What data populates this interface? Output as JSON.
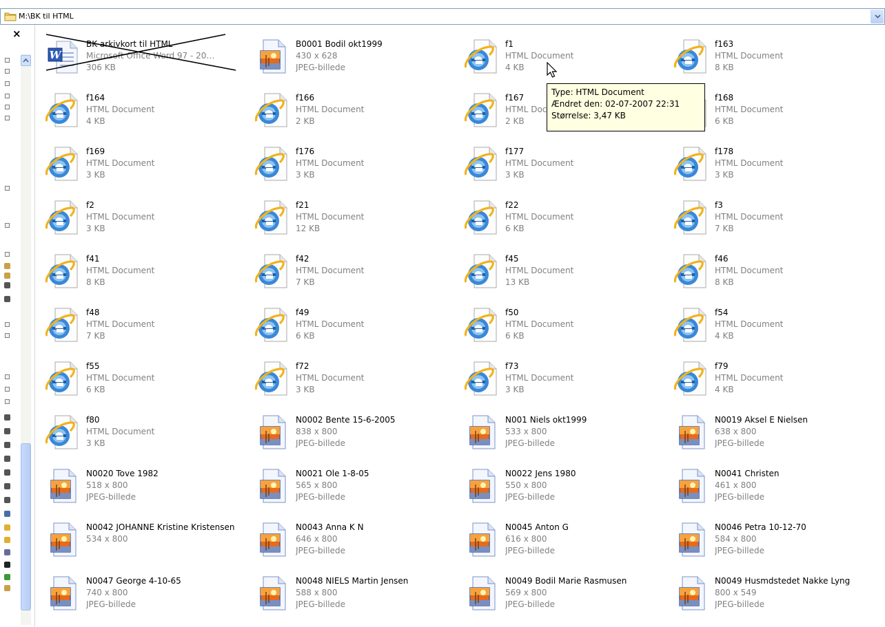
{
  "address": {
    "path": "M:\\BK til HTML"
  },
  "leftpane": {
    "close_label": "×"
  },
  "tooltip": {
    "type": "Type: HTML Document",
    "modified": "Ændret den: 02-07-2007 22:31",
    "size": "Størrelse: 3,47 KB"
  },
  "files": [
    {
      "name": "BK arkivkort til HTML",
      "line2": "Microsoft Office Word 97 - 20…",
      "line3": "306 KB",
      "icon": "word-doc-icon"
    },
    {
      "name": "B0001 Bodil okt1999",
      "line2": "430 x 628",
      "line3": "JPEG-billede",
      "icon": "jpeg-image-icon"
    },
    {
      "name": "f1",
      "line2": "HTML Document",
      "line3": "4 KB",
      "icon": "ie-html-icon"
    },
    {
      "name": "f163",
      "line2": "HTML Document",
      "line3": "8 KB",
      "icon": "ie-html-icon"
    },
    {
      "name": "f164",
      "line2": "HTML Document",
      "line3": "4 KB",
      "icon": "ie-html-icon"
    },
    {
      "name": "f166",
      "line2": "HTML Document",
      "line3": "2 KB",
      "icon": "ie-html-icon"
    },
    {
      "name": "f167",
      "line2": "HTML Document",
      "line3": "2 KB",
      "icon": "ie-html-icon"
    },
    {
      "name": "f168",
      "line2": "HTML Document",
      "line3": "6 KB",
      "icon": "ie-html-icon"
    },
    {
      "name": "f169",
      "line2": "HTML Document",
      "line3": "3 KB",
      "icon": "ie-html-icon"
    },
    {
      "name": "f176",
      "line2": "HTML Document",
      "line3": "3 KB",
      "icon": "ie-html-icon"
    },
    {
      "name": "f177",
      "line2": "HTML Document",
      "line3": "3 KB",
      "icon": "ie-html-icon"
    },
    {
      "name": "f178",
      "line2": "HTML Document",
      "line3": "3 KB",
      "icon": "ie-html-icon"
    },
    {
      "name": "f2",
      "line2": "HTML Document",
      "line3": "3 KB",
      "icon": "ie-html-icon"
    },
    {
      "name": "f21",
      "line2": "HTML Document",
      "line3": "12 KB",
      "icon": "ie-html-icon"
    },
    {
      "name": "f22",
      "line2": "HTML Document",
      "line3": "6 KB",
      "icon": "ie-html-icon"
    },
    {
      "name": "f3",
      "line2": "HTML Document",
      "line3": "7 KB",
      "icon": "ie-html-icon"
    },
    {
      "name": "f41",
      "line2": "HTML Document",
      "line3": "8 KB",
      "icon": "ie-html-icon"
    },
    {
      "name": "f42",
      "line2": "HTML Document",
      "line3": "7 KB",
      "icon": "ie-html-icon"
    },
    {
      "name": "f45",
      "line2": "HTML Document",
      "line3": "13 KB",
      "icon": "ie-html-icon"
    },
    {
      "name": "f46",
      "line2": "HTML Document",
      "line3": "8 KB",
      "icon": "ie-html-icon"
    },
    {
      "name": "f48",
      "line2": "HTML Document",
      "line3": "7 KB",
      "icon": "ie-html-icon"
    },
    {
      "name": "f49",
      "line2": "HTML Document",
      "line3": "6 KB",
      "icon": "ie-html-icon"
    },
    {
      "name": "f50",
      "line2": "HTML Document",
      "line3": "6 KB",
      "icon": "ie-html-icon"
    },
    {
      "name": "f54",
      "line2": "HTML Document",
      "line3": "4 KB",
      "icon": "ie-html-icon"
    },
    {
      "name": "f55",
      "line2": "HTML Document",
      "line3": "6 KB",
      "icon": "ie-html-icon"
    },
    {
      "name": "f72",
      "line2": "HTML Document",
      "line3": "3 KB",
      "icon": "ie-html-icon"
    },
    {
      "name": "f73",
      "line2": "HTML Document",
      "line3": "3 KB",
      "icon": "ie-html-icon"
    },
    {
      "name": "f79",
      "line2": "HTML Document",
      "line3": "4 KB",
      "icon": "ie-html-icon"
    },
    {
      "name": "f80",
      "line2": "HTML Document",
      "line3": "3 KB",
      "icon": "ie-html-icon"
    },
    {
      "name": "N0002 Bente 15-6-2005",
      "line2": "838 x 800",
      "line3": "JPEG-billede",
      "icon": "jpeg-image-icon"
    },
    {
      "name": "N001 Niels okt1999",
      "line2": "533 x 800",
      "line3": "JPEG-billede",
      "icon": "jpeg-image-icon"
    },
    {
      "name": "N0019 Aksel E Nielsen",
      "line2": "638 x 800",
      "line3": "JPEG-billede",
      "icon": "jpeg-image-icon"
    },
    {
      "name": "N0020 Tove 1982",
      "line2": "518 x 800",
      "line3": "JPEG-billede",
      "icon": "jpeg-image-icon"
    },
    {
      "name": "N0021 Ole 1-8-05",
      "line2": "565 x 800",
      "line3": "JPEG-billede",
      "icon": "jpeg-image-icon"
    },
    {
      "name": "N0022 Jens 1980",
      "line2": "550 x 800",
      "line3": "JPEG-billede",
      "icon": "jpeg-image-icon"
    },
    {
      "name": "N0041 Christen",
      "line2": "461 x 800",
      "line3": "JPEG-billede",
      "icon": "jpeg-image-icon"
    },
    {
      "name": "N0042 JOHANNE Kristine Kristensen",
      "line2": "534 x 800",
      "line3": "",
      "icon": "jpeg-image-icon"
    },
    {
      "name": "N0043 Anna K N",
      "line2": "646 x 800",
      "line3": "JPEG-billede",
      "icon": "jpeg-image-icon"
    },
    {
      "name": "N0045 Anton G",
      "line2": "616 x 800",
      "line3": "JPEG-billede",
      "icon": "jpeg-image-icon"
    },
    {
      "name": "N0046 Petra 10-12-70",
      "line2": "584 x 800",
      "line3": "JPEG-billede",
      "icon": "jpeg-image-icon"
    },
    {
      "name": "N0047 George 4-10-65",
      "line2": "740 x 800",
      "line3": "JPEG-billede",
      "icon": "jpeg-image-icon"
    },
    {
      "name": "N0048 NIELS Martin Jensen",
      "line2": "588 x 800",
      "line3": "JPEG-billede",
      "icon": "jpeg-image-icon"
    },
    {
      "name": "N0049 Bodil Marie Rasmusen",
      "line2": "569 x 800",
      "line3": "JPEG-billede",
      "icon": "jpeg-image-icon"
    },
    {
      "name": "N0049 Husmdstedet Nakke Lyng",
      "line2": "800 x 549",
      "line3": "JPEG-billede",
      "icon": "jpeg-image-icon"
    }
  ]
}
